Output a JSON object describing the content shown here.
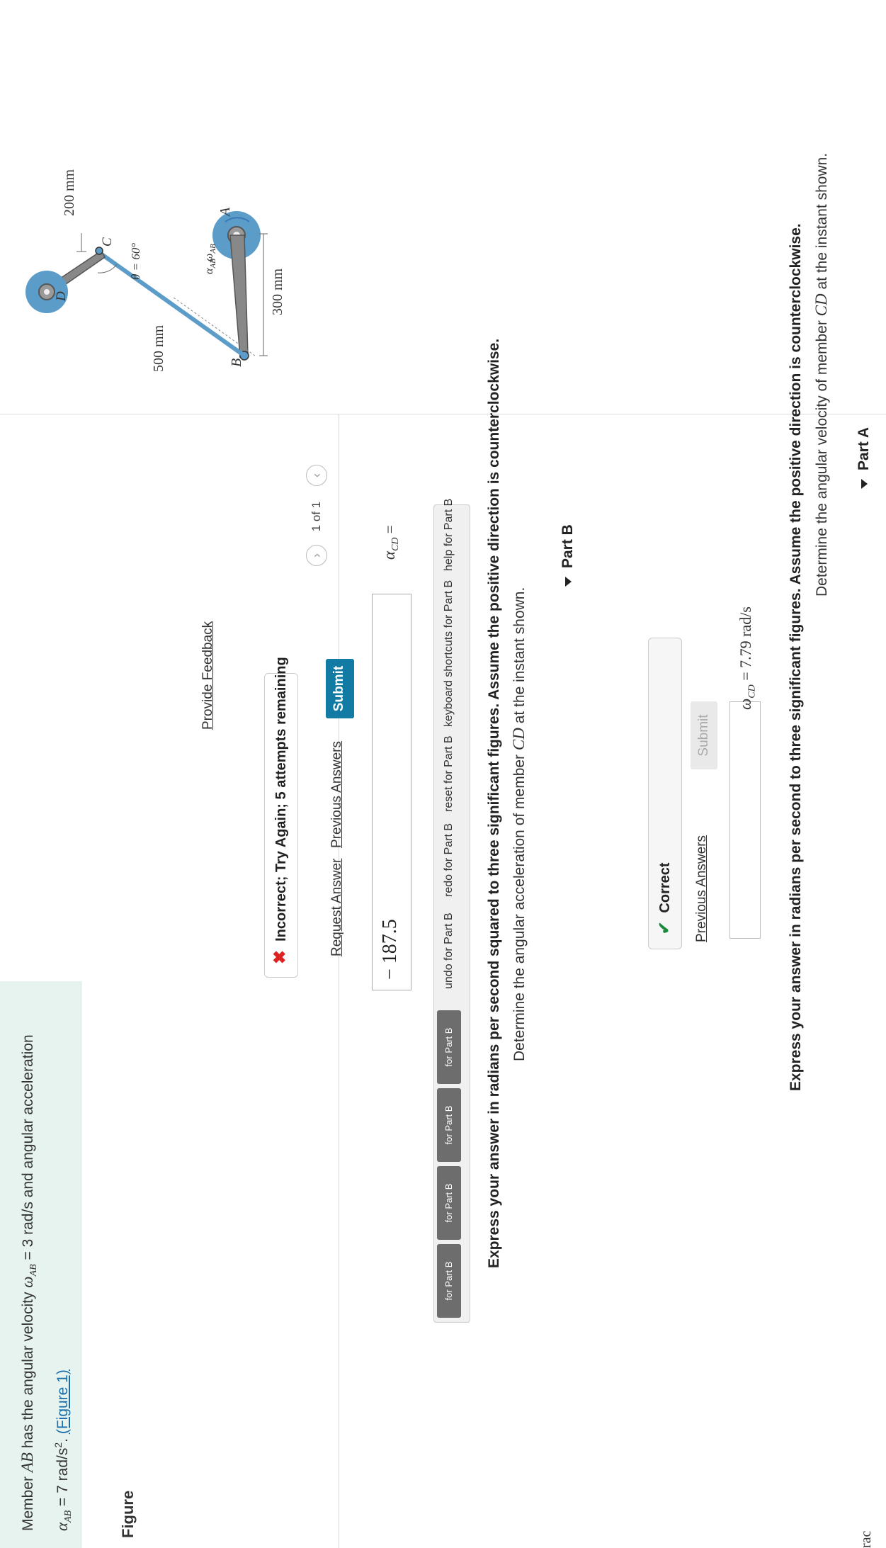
{
  "problem": {
    "line1_pre": "Member",
    "member_ab": "AB",
    "line1_mid": "has the angular velocity",
    "omega_sym": "ω",
    "omega_sub": "AB",
    "omega_val": "= 3 rad/s and angular acceleration",
    "alpha_sym": "α",
    "alpha_sub": "AB",
    "alpha_val": "= 7 rad/s",
    "alpha_exp": "2",
    "period": ".",
    "figure_link": "(Figure 1)"
  },
  "figure": {
    "heading": "Figure",
    "labels": {
      "A": "A",
      "B": "B",
      "C": "C",
      "D": "D",
      "dim_300": "300 mm",
      "dim_500": "500 mm",
      "dim_200": "200 mm",
      "theta": "θ = 60°",
      "omega_ab": "ω",
      "omega_ab_sub": "AB",
      "alpha_ab": "α",
      "alpha_ab_sub": "AB"
    },
    "pager": {
      "prev": "‹",
      "next": "›",
      "count": "1 of 1"
    }
  },
  "partA": {
    "title": "Part A",
    "question_pre": "Determine the angular velocity of member",
    "member": "CD",
    "question_post": "at the instant shown.",
    "instruction": "Express your answer in radians per second to three significant figures. Assume the positive direction is counterclockwise.",
    "answer_label": "ω",
    "answer_sub": "CD",
    "answer_value": "= 7.79",
    "answer_unit": "rad/s",
    "submit": "Submit",
    "previous_answers": "Previous Answers",
    "status": "Correct"
  },
  "partB": {
    "title": "Part B",
    "question_pre": "Determine the angular acceleration of member",
    "member": "CD",
    "question_post": "at the instant shown.",
    "instruction": "Express your answer in radians per second squared to three significant figures. Assume the positive direction is counterclockwise.",
    "toolbar": {
      "templates": "for Part B",
      "vec": "for Part B",
      "matrix": "for Part B",
      "units": "for Part B",
      "undo": "undo for Part B",
      "redo": "redo for Part B",
      "reset": "reset for Part B",
      "keyboard": "keyboard shortcuts for Part B",
      "help": "help for Part B"
    },
    "answer_label": "α",
    "answer_sub": "CD",
    "answer_eq": "=",
    "answer_value": "− 187.5",
    "unit_cut": "rac",
    "submit": "Submit",
    "previous_answers": "Previous Answers",
    "request_answer": "Request Answer",
    "status": "Incorrect; Try Again; 5 attempts remaining"
  },
  "feedback": "Provide Feedback"
}
